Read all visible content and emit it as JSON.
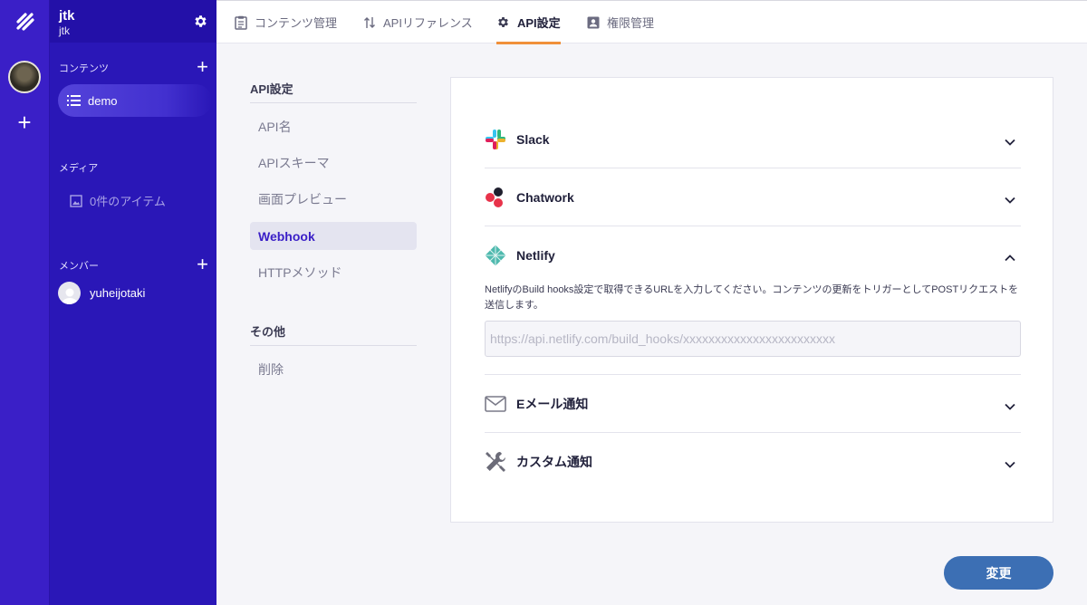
{
  "workspace": {
    "title": "jtk",
    "subtitle": "jtk"
  },
  "sidebar": {
    "contents_label": "コンテンツ",
    "contents_items": [
      {
        "label": "demo",
        "icon": "list-icon"
      }
    ],
    "media_label": "メディア",
    "media_item": "0件のアイテム",
    "members_label": "メンバー",
    "members": [
      {
        "name": "yuheijotaki"
      }
    ]
  },
  "tabs": [
    {
      "label": "コンテンツ管理",
      "icon": "clipboard-icon"
    },
    {
      "label": "APIリファレンス",
      "icon": "sort-arrows-icon"
    },
    {
      "label": "API設定",
      "icon": "gear-icon",
      "active": true
    },
    {
      "label": "権限管理",
      "icon": "person-badge-icon"
    }
  ],
  "settings_menu": {
    "section_api": "API設定",
    "items": [
      "API名",
      "APIスキーマ",
      "画面プレビュー",
      "Webhook",
      "HTTPメソッド"
    ],
    "active_item": "Webhook",
    "section_other": "その他",
    "other_items": [
      "削除"
    ]
  },
  "webhooks": {
    "slack": "Slack",
    "chatwork": "Chatwork",
    "netlify": "Netlify",
    "netlify_desc": "NetlifyのBuild hooks設定で取得できるURLを入力してください。コンテンツの更新をトリガーとしてPOSTリクエストを送信します。",
    "netlify_placeholder": "https://api.netlify.com/build_hooks/xxxxxxxxxxxxxxxxxxxxxxxx",
    "email": "Eメール通知",
    "custom": "カスタム通知"
  },
  "submit_label": "変更",
  "colors": {
    "sidebar": "#2a17b7",
    "rail": "#3a1fc7",
    "accent_tab": "#f0903a",
    "submit": "#3c6fb4"
  }
}
